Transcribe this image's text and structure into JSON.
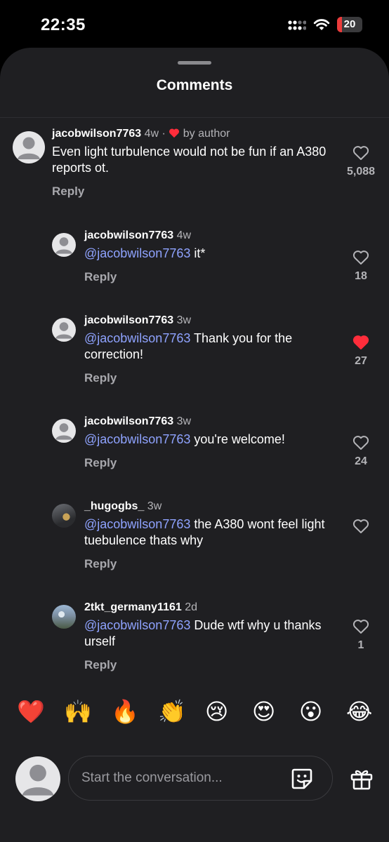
{
  "status_bar": {
    "time": "22:35",
    "battery_level": "20",
    "battery_fraction": 0.2,
    "battery_color": "#eb3b3b"
  },
  "sheet": {
    "title": "Comments"
  },
  "comments": [
    {
      "username": "jacobwilson7763",
      "age": "4w",
      "separator": "·",
      "author_badge": "by author",
      "text": "Even light turbulence would not be fun if an A380 reports ot.",
      "reply_label": "Reply",
      "likes": "5,088",
      "liked": false,
      "avatar": "default-avatar"
    },
    {
      "username": "jacobwilson7763",
      "age": "4w",
      "mention": "@jacobwilson7763",
      "text": " it*",
      "reply_label": "Reply",
      "likes": "18",
      "liked": false,
      "avatar": "default-avatar"
    },
    {
      "username": "jacobwilson7763",
      "age": "3w",
      "mention": "@jacobwilson7763",
      "text": " Thank you for the correction!",
      "reply_label": "Reply",
      "likes": "27",
      "liked": true,
      "avatar": "default-avatar"
    },
    {
      "username": "jacobwilson7763",
      "age": "3w",
      "mention": "@jacobwilson7763",
      "text": " you're welcome!",
      "reply_label": "Reply",
      "likes": "24",
      "liked": false,
      "avatar": "default-avatar"
    },
    {
      "username": "_hugogbs_",
      "age": "3w",
      "mention": "@jacobwilson7763",
      "text": " the A380 wont feel light tuebulence thats why",
      "reply_label": "Reply",
      "likes": "",
      "liked": false,
      "avatar": "photo-avatar"
    },
    {
      "username": "2tkt_germany1161",
      "age": "2d",
      "mention": "@jacobwilson7763",
      "text": " Dude wtf why u thanks urself",
      "reply_label": "Reply",
      "likes": "1",
      "liked": false,
      "avatar": "photo-avatar"
    }
  ],
  "reactions": [
    "❤️",
    "🙌",
    "🔥",
    "👏",
    "😢",
    "😍",
    "😮",
    "😂"
  ],
  "composer": {
    "placeholder": "Start the conversation..."
  },
  "colors": {
    "accent_mention": "#8fa3ff",
    "like_red": "#ff2d3b",
    "sheet_bg": "#1f1f22"
  }
}
